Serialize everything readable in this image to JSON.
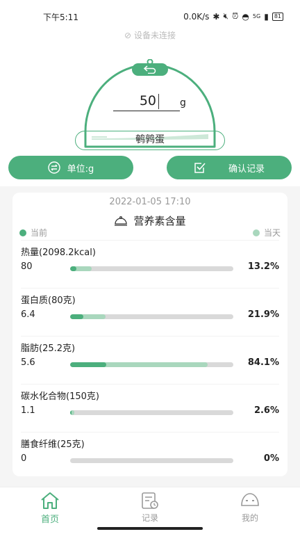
{
  "status_bar": {
    "time": "下午5:11",
    "net_speed": "0.0K/s",
    "signal": "5G",
    "battery": "81"
  },
  "device_status": "设备未连接",
  "scale": {
    "weight": "50",
    "unit": "g",
    "food_name": "鹌鹑蛋"
  },
  "actions": {
    "unit_label": "单位:g",
    "confirm_label": "确认记录"
  },
  "card": {
    "datetime": "2022-01-05 17:10",
    "title": "营养素含量",
    "legend": {
      "now": "当前",
      "day": "当天"
    },
    "nutrients": [
      {
        "name": "热量(2098.2kcal)",
        "value": "80",
        "percent": "13.2%",
        "now_fraction": 0.038,
        "day_fraction": 0.132
      },
      {
        "name": "蛋白质(80克)",
        "value": "6.4",
        "percent": "21.9%",
        "now_fraction": 0.08,
        "day_fraction": 0.219
      },
      {
        "name": "脂肪(25.2克)",
        "value": "5.6",
        "percent": "84.1%",
        "now_fraction": 0.222,
        "day_fraction": 0.841
      },
      {
        "name": "碳水化合物(150克)",
        "value": "1.1",
        "percent": "2.6%",
        "now_fraction": 0.007,
        "day_fraction": 0.026
      },
      {
        "name": "膳食纤维(25克)",
        "value": "0",
        "percent": "0%",
        "now_fraction": 0,
        "day_fraction": 0
      }
    ]
  },
  "nav": {
    "home": "首页",
    "records": "记录",
    "mine": "我的"
  },
  "colors": {
    "accent": "#4caf7d",
    "accent_light": "#a9d7bd",
    "track": "#d9d9d9"
  }
}
